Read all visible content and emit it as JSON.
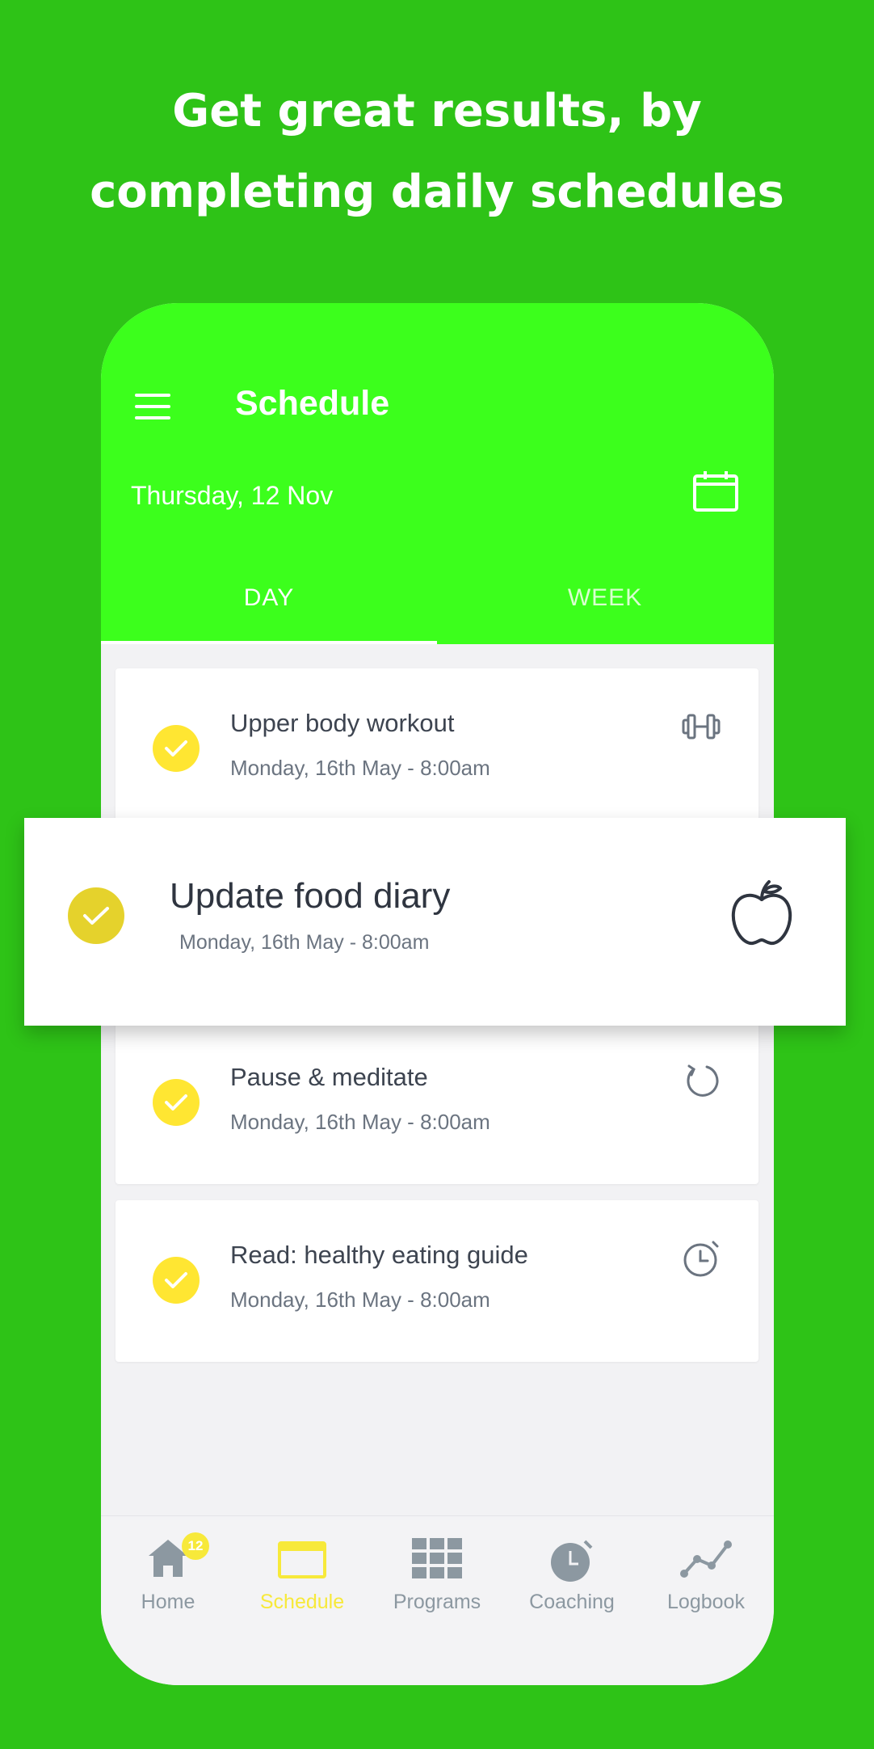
{
  "headline": {
    "line1": "Get great results, by",
    "line2": "completing daily schedules"
  },
  "app": {
    "title": "Schedule",
    "date": "Thursday, 12 Nov",
    "tabs": [
      {
        "label": "DAY",
        "active": true
      },
      {
        "label": "WEEK",
        "active": false
      }
    ]
  },
  "schedule_items": [
    {
      "title": "Upper body workout",
      "subtitle": "Monday, 16th May - 8:00am",
      "icon": "dumbbell-icon",
      "completed": true
    },
    {
      "title": "Update food diary",
      "subtitle": "Monday, 16th May - 8:00am",
      "icon": "apple-icon",
      "completed": true
    },
    {
      "title": "Pause & meditate",
      "subtitle": "Monday, 16th May - 8:00am",
      "icon": "refresh-icon",
      "completed": true
    },
    {
      "title": "Read: healthy eating guide",
      "subtitle": "Monday, 16th May - 8:00am",
      "icon": "clock-icon",
      "completed": true
    }
  ],
  "nav": {
    "items": [
      {
        "label": "Home",
        "icon": "home-icon",
        "badge": "12"
      },
      {
        "label": "Schedule",
        "icon": "calendar-icon",
        "active": true
      },
      {
        "label": "Programs",
        "icon": "grid-icon"
      },
      {
        "label": "Coaching",
        "icon": "stopwatch-icon"
      },
      {
        "label": "Logbook",
        "icon": "chart-icon"
      }
    ]
  },
  "colors": {
    "background": "#2EC317",
    "header": "#3CFF1C",
    "check": "#FFE632",
    "active_nav": "#F7E93A",
    "inactive_nav": "#8C98A1"
  }
}
